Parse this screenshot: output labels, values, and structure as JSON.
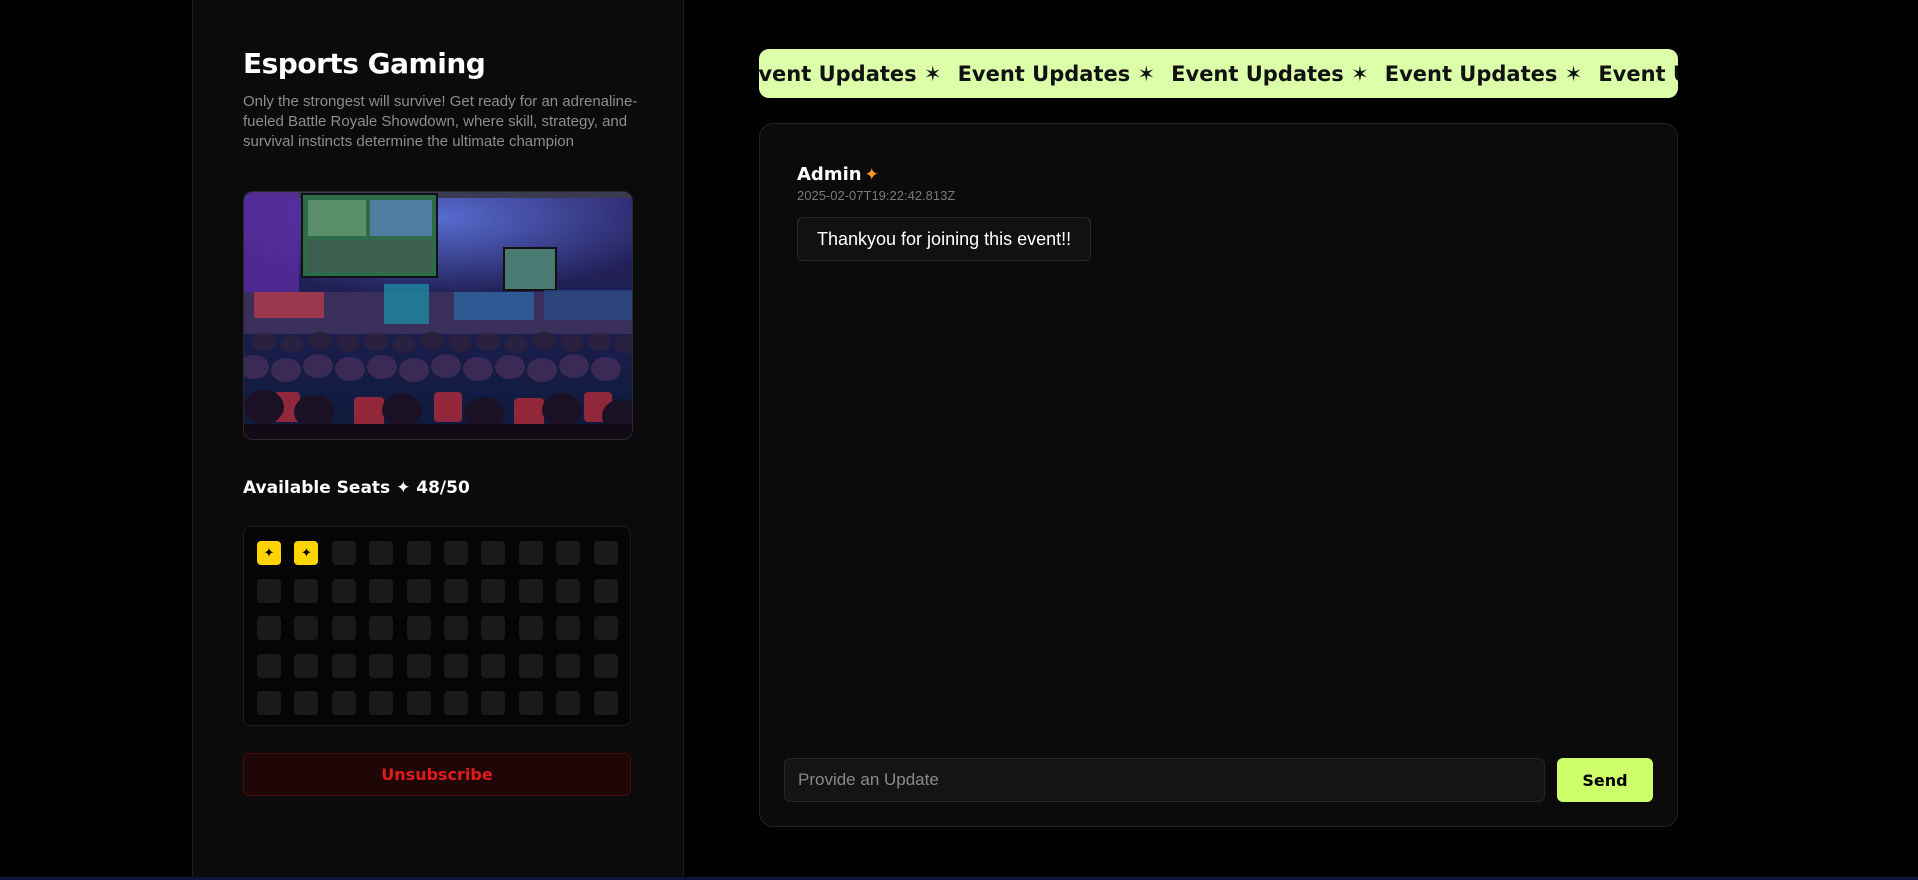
{
  "event": {
    "title": "Esports Gaming",
    "description": "Only the strongest will survive! Get ready for an adrenaline-fueled Battle Royale Showdown, where skill, strategy, and survival instincts determine the ultimate champion",
    "image_alt": "Esports arena with crowd and large screens"
  },
  "seats": {
    "heading": "Available Seats ✦ 48/50",
    "available": 48,
    "total": 50,
    "taken_count": 2,
    "taken_marker": "✦"
  },
  "actions": {
    "unsubscribe_label": "Unsubscribe"
  },
  "updates": {
    "marquee_label": "Event Updates",
    "marquee_separator": "✶",
    "messages": [
      {
        "author": "Admin",
        "author_badge": "✦",
        "timestamp": "2025-02-07T19:22:42.813Z",
        "text": "Thankyou for joining this event!!"
      }
    ]
  },
  "composer": {
    "placeholder": "Provide an Update",
    "value": "",
    "send_label": "Send"
  },
  "colors": {
    "accent_lime": "#dcffaa",
    "send_button": "#ccff6a",
    "seat_taken": "#ffd400",
    "danger": "#e21a1a",
    "admin_badge": "#ff9c1a"
  },
  "icons": {
    "seat_taken": "sparkle-icon",
    "admin_badge": "sparkle-icon",
    "marquee_separator": "asterisk-star-icon"
  }
}
